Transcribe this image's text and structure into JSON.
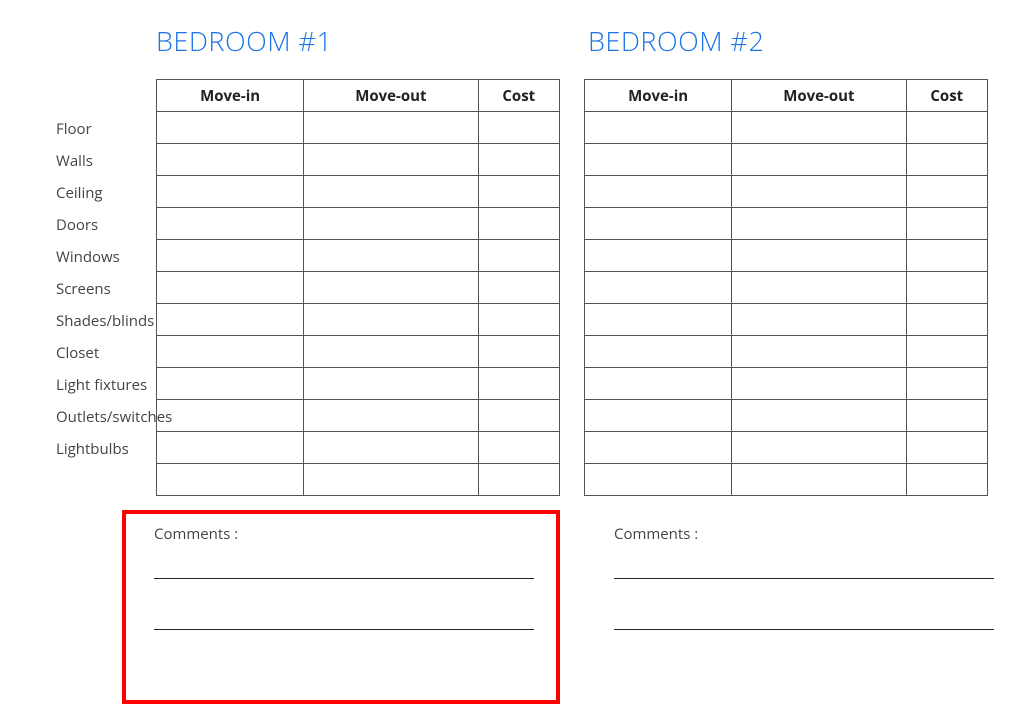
{
  "columns": [
    "Move-in",
    "Move-out",
    "Cost"
  ],
  "row_labels": [
    "Floor",
    "Walls",
    "Ceiling",
    "Doors",
    "Windows",
    "Screens",
    "Shades/blinds",
    "Closet",
    "Light fixtures",
    "Outlets/switches",
    "Lightbulbs"
  ],
  "extra_blank_rows": 1,
  "sections": [
    {
      "title": "BEDROOM #1",
      "comments_label": "Comments :",
      "highlight": true
    },
    {
      "title": "BEDROOM #2",
      "comments_label": "Comments :",
      "highlight": false
    }
  ]
}
